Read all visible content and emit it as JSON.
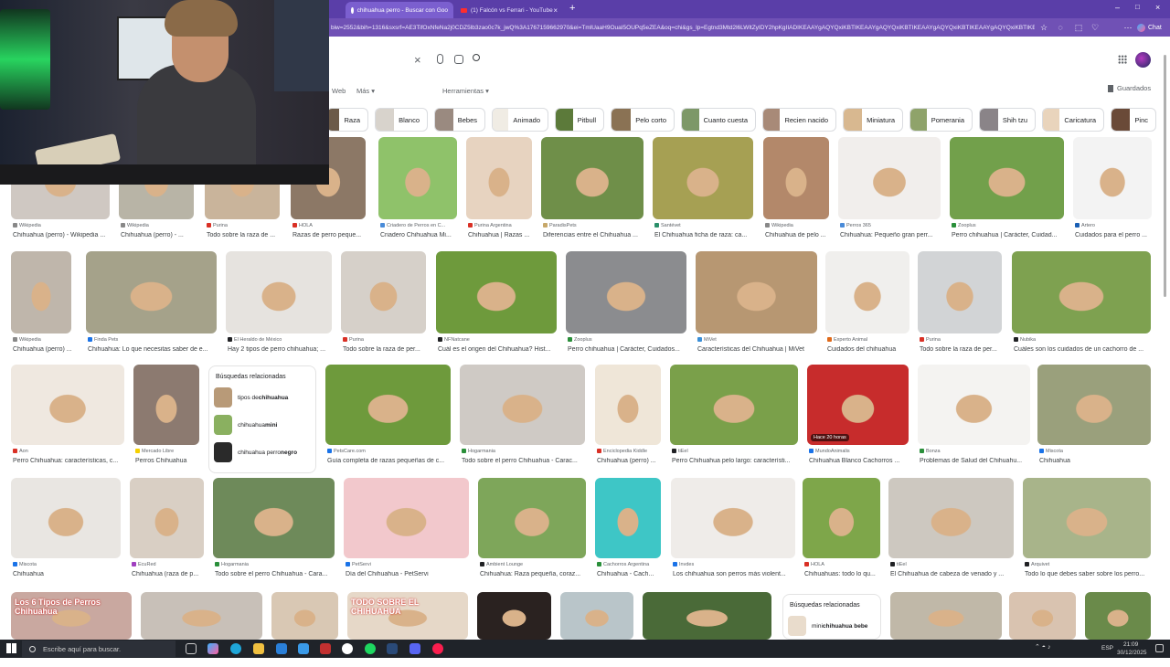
{
  "browser": {
    "tabs": [
      {
        "title": "chihuahua perro - Buscar con Goo",
        "active": true,
        "favicon": "google-g-icon"
      },
      {
        "title": "(1) Falcón vs Ferrari - YouTube",
        "active": false,
        "favicon": "youtube-icon"
      }
    ],
    "new_tab_label": "+",
    "url": "biw=2552&bih=1316&sxsrf=AE3TifOxNfeNa2j0CDZ5lb3zao0c7k_jwQ%3A1767159662970&ei=TmlUaaH9OuaI5OUPq5eZEA&oq=chi&gs_lp=Egtnd3Mtd2l6LWltZyIDY2hpKgIIADIKEAAYgAQYQxiKBTIKEAAYgAQYQxiKBTIKEAAYgAQYQxiKBTIKEAAYgAQYQxiKBTIKEAAYgAQYQxiKBTIKEAAYgAQ",
    "chat_label": "Chat",
    "accent": "#5a3ea8"
  },
  "search": {
    "clear_icon": "close-icon",
    "voice_icon": "mic-icon",
    "lens_icon": "camera-lens-icon",
    "search_icon": "search-icon",
    "apps_icon": "grid-icon"
  },
  "filters": {
    "web": "Web",
    "more": "Más",
    "tools": "Herramientas",
    "saved": "Guardados"
  },
  "chips": [
    {
      "label": "Raza",
      "color": "#6b5a48"
    },
    {
      "label": "Blanco",
      "color": "#d8d3cc"
    },
    {
      "label": "Bebes",
      "color": "#9a8a80"
    },
    {
      "label": "Animado",
      "color": "#f0ece4"
    },
    {
      "label": "Pitbull",
      "color": "#5c7a3a"
    },
    {
      "label": "Pelo corto",
      "color": "#8a7254"
    },
    {
      "label": "Cuanto cuesta",
      "color": "#7d9868"
    },
    {
      "label": "Recien nacido",
      "color": "#a88a78"
    },
    {
      "label": "Miniatura",
      "color": "#d8b890"
    },
    {
      "label": "Pomerania",
      "color": "#8fa36a"
    },
    {
      "label": "Shih tzu",
      "color": "#8a8488"
    },
    {
      "label": "Caricatura",
      "color": "#e9d4bc"
    },
    {
      "label": "Pinc",
      "color": "#6a4a38"
    }
  ],
  "results": {
    "row1": [
      {
        "source": "Wikipedia",
        "title": "Chihuahua (perro) - Wikipedia ...",
        "color": "#cfc8c2",
        "fav": "#888888"
      },
      {
        "source": "Wikipedia",
        "title": "Chihuahua (perro) - ...",
        "color": "#b8b4a6",
        "fav": "#888888"
      },
      {
        "source": "Purina",
        "title": "Todo sobre la raza de ...",
        "color": "#c9b49b",
        "fav": "#d93025"
      },
      {
        "source": "HOLA",
        "title": "Razas de perro peque...",
        "color": "#8c7866",
        "fav": "#d93025"
      },
      {
        "source": "Criadero de Perros en C...",
        "title": "Criadero Chihuahua Mi...",
        "color": "#8fc26a",
        "fav": "#4a8bd8"
      },
      {
        "source": "Purina Argentina",
        "title": "Chihuahua | Razas ...",
        "color": "#e7d3c0",
        "fav": "#d93025"
      },
      {
        "source": "ParadisPets",
        "title": "Diferencias entre el Chihuahua ...",
        "color": "#6f8f49",
        "fav": "#c7a86a"
      },
      {
        "source": "Santévet",
        "title": "El Chihuahua ficha de raza: ca...",
        "color": "#a6a053",
        "fav": "#2a8f6a"
      },
      {
        "source": "Wikipedia",
        "title": "Chihuahua de pelo ...",
        "color": "#b3886a",
        "fav": "#888888"
      },
      {
        "source": "Perros 365",
        "title": "Chihuahua: Pequeño gran perr...",
        "color": "#f1eeec",
        "fav": "#4a8bd8"
      },
      {
        "source": "Zooplus",
        "title": "Perro chihuahua | Carácter, Cuidad...",
        "color": "#72a04b",
        "fav": "#2a8f3a"
      },
      {
        "source": "Artero",
        "title": "Cuidados para el perro ...",
        "color": "#f3f3f3",
        "fav": "#1a5fb4"
      }
    ],
    "row2": [
      {
        "source": "Wikipedia",
        "title": "Chihuahua (perro) ...",
        "color": "#bfb6ab",
        "fav": "#888888"
      },
      {
        "source": "Finda Pets",
        "title": "Chihuahua: Lo que necesitas saber de e...",
        "color": "#a5a28a",
        "fav": "#1a73e8"
      },
      {
        "source": "El Heraldo de México",
        "title": "Hay 2 tipos de perro chihuahua; ...",
        "color": "#e6e3df",
        "fav": "#202124"
      },
      {
        "source": "Purina",
        "title": "Todo sobre la raza de per...",
        "color": "#d6d0c9",
        "fav": "#d93025"
      },
      {
        "source": "NFNatcane",
        "title": "Cuál es el origen del Chihuahua? Hist...",
        "color": "#6e9a3c",
        "fav": "#202124"
      },
      {
        "source": "Zooplus",
        "title": "Perro chihuahua | Carácter, Cuidados...",
        "color": "#8b8c8f",
        "fav": "#2a8f3a"
      },
      {
        "source": "MiVet",
        "title": "Características del Chihuahua | MiVet",
        "color": "#b79772",
        "fav": "#3a8fd8"
      },
      {
        "source": "Experto Animal",
        "title": "Cuidados del chihuahua",
        "color": "#f0efed",
        "fav": "#e06a1a"
      },
      {
        "source": "Purina",
        "title": "Todo sobre la raza de per...",
        "color": "#d2d4d6",
        "fav": "#d93025"
      },
      {
        "source": "Nubika",
        "title": "Cuáles son los cuidados de un cachorro de ...",
        "color": "#7ea150",
        "fav": "#202124"
      }
    ],
    "row3": [
      {
        "source": "Aon",
        "title": "Perro Chihuahua: características, c...",
        "color": "#efe8e0",
        "fav": "#d93025"
      },
      {
        "source": "Mercado Libre",
        "title": "Perros Chihuahua",
        "color": "#8c7a70",
        "fav": "#f5d000"
      },
      {
        "source": "PetsCare.com",
        "title": "Guía completa de razas pequeñas de c...",
        "color": "#6e9a3c",
        "fav": "#1a73e8"
      },
      {
        "source": "Hogarmania",
        "title": "Todo sobre el perro Chihuahua - Carac...",
        "color": "#cfcac5",
        "fav": "#2a8f3a"
      },
      {
        "source": "Enciclopedia Kiddle",
        "title": "Chihuahua (perro) ...",
        "color": "#efe6d8",
        "fav": "#d93025"
      },
      {
        "source": "tiÉel",
        "title": "Perro Chihuahua pelo largo: característi...",
        "color": "#7aa04a",
        "fav": "#202124"
      },
      {
        "source": "MundoAnimalis",
        "title": "Chihuahua Blanco Cachorros ...",
        "color": "#c72c2c",
        "fav": "#1a73e8",
        "badge": "Hace 20 horas"
      },
      {
        "source": "Bonza",
        "title": "Problemas de Salud del Chihuahu...",
        "color": "#f4f3f1",
        "fav": "#2a8f3a"
      },
      {
        "source": "Miscota",
        "title": "Chihuahua",
        "color": "#9aa07c",
        "fav": "#1a73e8"
      }
    ],
    "row4": [
      {
        "source": "Miscota",
        "title": "Chihuahua",
        "color": "#e9e6e2",
        "fav": "#1a73e8"
      },
      {
        "source": "EcuRed",
        "title": "Chihuahua (raza de p...",
        "color": "#d9cfc4",
        "fav": "#a040c0"
      },
      {
        "source": "Hogarmania",
        "title": "Todo sobre el perro Chihuahua - Cara...",
        "color": "#6e8a5a",
        "fav": "#2a8f3a"
      },
      {
        "source": "PetServi",
        "title": "Día del Chihuahua - PetServi",
        "color": "#f2c8cc",
        "fav": "#1a73e8"
      },
      {
        "source": "Ambient Lounge",
        "title": "Chihuahua: Raza pequeña, coraz...",
        "color": "#7ea65a",
        "fav": "#202124"
      },
      {
        "source": "Cachorros Argentina",
        "title": "Chihuahua - Cach...",
        "color": "#3ec6c6",
        "fav": "#2a8f3a"
      },
      {
        "source": "Invdes",
        "title": "Los chihuahua son perros más violent...",
        "color": "#efece9",
        "fav": "#1a73e8"
      },
      {
        "source": "HOLA",
        "title": "Chihuahuas: todo lo qu...",
        "color": "#7ea64a",
        "fav": "#d93025"
      },
      {
        "source": "tiÉel",
        "title": "El Chihuahua de cabeza de venado y ...",
        "color": "#cdc8c0",
        "fav": "#202124"
      },
      {
        "source": "Arquivet",
        "title": "Todo lo que debes saber sobre los perro...",
        "color": "#a8b48a",
        "fav": "#202124"
      }
    ],
    "row5": [
      {
        "color": "#c9a8a0",
        "overlay": "Los 6 Tipos de Perros Chihuahua"
      },
      {
        "color": "#c8c0b8"
      },
      {
        "color": "#d9c8b4"
      },
      {
        "color": "#e6d8c8",
        "overlay": "TODO SOBRE EL CHIHUAHUA"
      },
      {
        "color": "#2a2220"
      },
      {
        "color": "#b9c5c9"
      },
      {
        "color": "#4a6a38"
      },
      {
        "color": "#c0b8a8"
      },
      {
        "color": "#d9c3b0"
      },
      {
        "color": "#6a8a4a"
      }
    ]
  },
  "related1": {
    "heading": "Búsquedas relacionadas",
    "items": [
      {
        "pre": "tipos de ",
        "bold": "chihuahua",
        "color": "#b89a78"
      },
      {
        "pre": "chihuahua ",
        "bold": "mini",
        "color": "#8ab060"
      },
      {
        "pre": "chihuahua perro ",
        "bold": "negro",
        "color": "#2a2a2a"
      }
    ]
  },
  "related2": {
    "heading": "Búsquedas relacionadas",
    "items": [
      {
        "pre": "mini ",
        "bold": "chihuahua bebe",
        "color": "#e9dccc"
      }
    ]
  },
  "taskbar": {
    "search_placeholder": "Escribe aquí para buscar.",
    "time": "21:09",
    "date": "30/12/2025",
    "lang": "ESP"
  }
}
